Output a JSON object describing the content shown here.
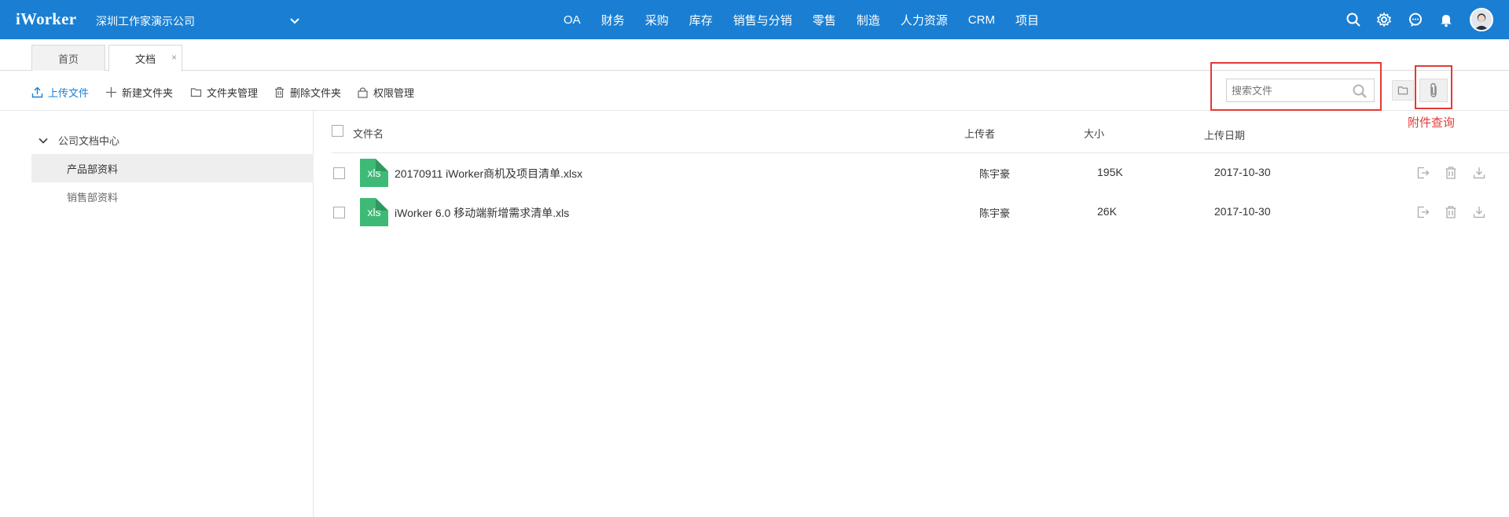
{
  "topbar": {
    "logo": "iWorker",
    "company": "深圳工作家演示公司",
    "nav": [
      "OA",
      "财务",
      "采购",
      "库存",
      "销售与分销",
      "零售",
      "制造",
      "人力资源",
      "CRM",
      "项目"
    ],
    "icons": [
      "search-icon",
      "gear-icon",
      "chat-icon",
      "bell-icon"
    ],
    "accent_color": "#1a7fd3"
  },
  "tabs": [
    {
      "label": "首页"
    },
    {
      "label": "文档",
      "close": "×"
    }
  ],
  "toolbar": {
    "upload": "上传文件",
    "new_folder": "新建文件夹",
    "folder_manage": "文件夹管理",
    "delete_folder": "删除文件夹",
    "permission": "权限管理"
  },
  "search": {
    "placeholder": "搜索文件"
  },
  "annotation": {
    "attach_query": "附件查询",
    "highlight_color": "#e53935"
  },
  "sidebar": {
    "root": "公司文档中心",
    "items": [
      {
        "label": "产品部资料",
        "active": true
      },
      {
        "label": "销售部资料",
        "active": false
      }
    ]
  },
  "file_list": {
    "headers": {
      "name": "文件名",
      "uploader": "上传者",
      "size": "大小",
      "date": "上传日期"
    },
    "rows": [
      {
        "type": "xls",
        "name": "20170911 iWorker商机及项目清单.xlsx",
        "uploader": "陈宇豪",
        "size": "195K",
        "date": "2017-10-30"
      },
      {
        "type": "xls",
        "name": "iWorker 6.0 移动端新增需求清单.xls",
        "uploader": "陈宇豪",
        "size": "26K",
        "date": "2017-10-30"
      }
    ]
  }
}
